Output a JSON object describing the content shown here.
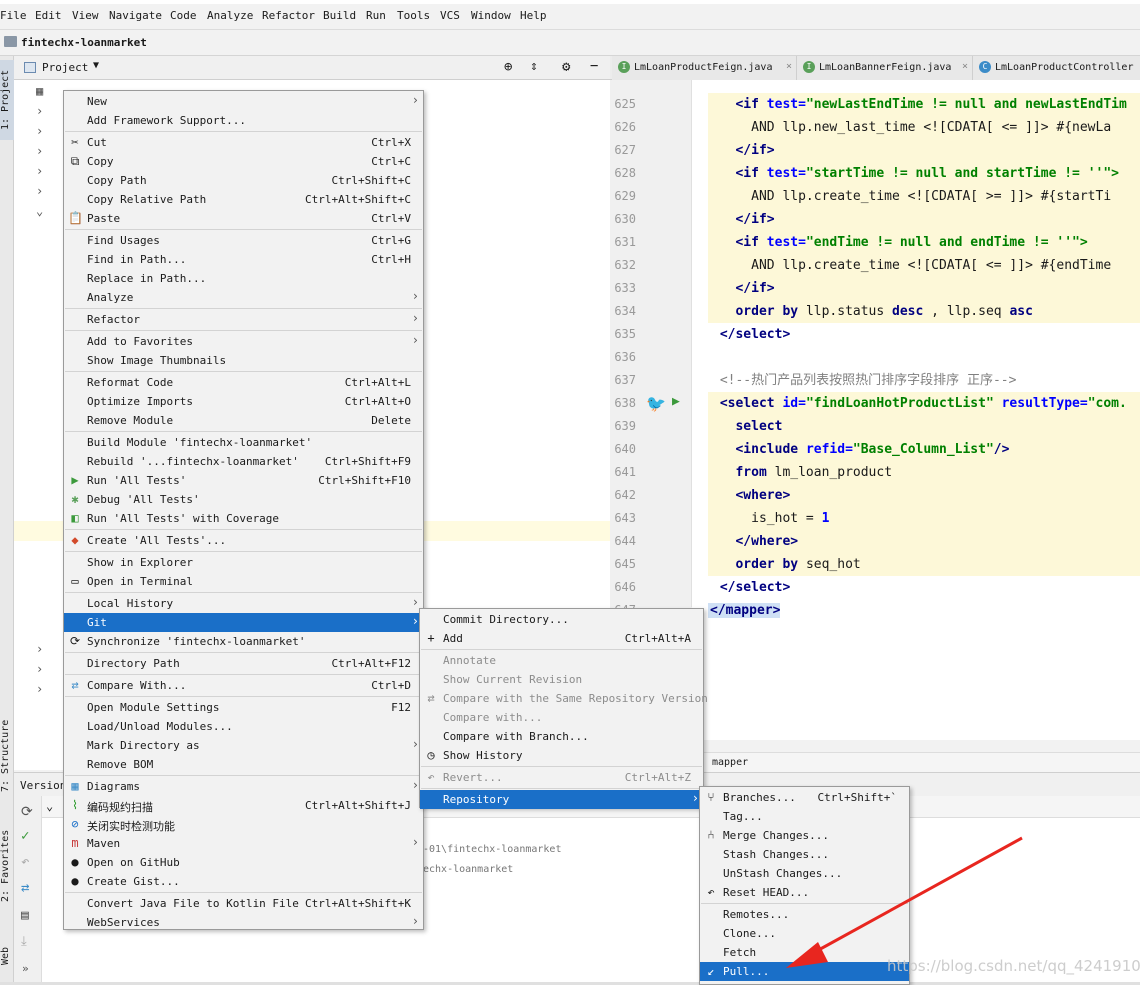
{
  "menubar": [
    "File",
    "Edit",
    "View",
    "Navigate",
    "Code",
    "Analyze",
    "Refactor",
    "Build",
    "Run",
    "Tools",
    "VCS",
    "Window",
    "Help"
  ],
  "project_title": "fintechx-loanmarket",
  "project_header": "Project",
  "left_strip": {
    "project": "1: Project",
    "structure": "7: Structure",
    "favorites": "2: Favorites",
    "web": "Web"
  },
  "tabs": [
    {
      "label": "LmLoanProductFeign.java",
      "icon": "I",
      "color": "#5aa05a"
    },
    {
      "label": "LmLoanBannerFeign.java",
      "icon": "I",
      "color": "#5aa05a"
    },
    {
      "label": "LmLoanProductController",
      "icon": "C",
      "color": "#3c8cc8"
    }
  ],
  "code_lines": [
    {
      "n": "625",
      "t": [
        [
          "   ",
          ""
        ],
        [
          "<if ",
          "tg"
        ],
        [
          "test=",
          "at"
        ],
        [
          "\"newLastEndTime != null and newLastEndTim",
          "vl"
        ]
      ]
    },
    {
      "n": "626",
      "t": [
        [
          "     AND llp.new_last_time <![CDATA[ <= ]]> #{newLa",
          ""
        ]
      ]
    },
    {
      "n": "627",
      "t": [
        [
          "   ",
          ""
        ],
        [
          "</if>",
          "tg"
        ]
      ]
    },
    {
      "n": "628",
      "t": [
        [
          "   ",
          ""
        ],
        [
          "<if ",
          "tg"
        ],
        [
          "test=",
          "at"
        ],
        [
          "\"startTime != null and startTime != ''\">",
          "vl"
        ]
      ]
    },
    {
      "n": "629",
      "t": [
        [
          "     AND llp.create_time <![CDATA[ >= ]]> #{startTi",
          ""
        ]
      ]
    },
    {
      "n": "630",
      "t": [
        [
          "   ",
          ""
        ],
        [
          "</if>",
          "tg"
        ]
      ]
    },
    {
      "n": "631",
      "t": [
        [
          "   ",
          ""
        ],
        [
          "<if ",
          "tg"
        ],
        [
          "test=",
          "at"
        ],
        [
          "\"endTime != null and endTime != ''\">",
          "vl"
        ]
      ]
    },
    {
      "n": "632",
      "t": [
        [
          "     AND llp.create_time <![CDATA[ <= ]]> #{endTime",
          ""
        ]
      ]
    },
    {
      "n": "633",
      "t": [
        [
          "   ",
          ""
        ],
        [
          "</if>",
          "tg"
        ]
      ]
    },
    {
      "n": "634",
      "t": [
        [
          "   ",
          ""
        ],
        [
          "order by ",
          "kw"
        ],
        [
          "llp.status ",
          ""
        ],
        [
          "desc",
          "kw"
        ],
        [
          " , llp.seq ",
          ""
        ],
        [
          "asc",
          "kw"
        ]
      ]
    },
    {
      "n": "635",
      "t": [
        [
          " ",
          ""
        ],
        [
          "</select>",
          "tg"
        ]
      ]
    },
    {
      "n": "636",
      "t": [
        [
          "",
          ""
        ]
      ]
    },
    {
      "n": "637",
      "t": [
        [
          " ",
          ""
        ],
        [
          "<!--热门产品列表按照热门排序字段排序 正序-->",
          "cm"
        ]
      ]
    },
    {
      "n": "638",
      "t": [
        [
          " ",
          ""
        ],
        [
          "<select ",
          "tg"
        ],
        [
          "id=",
          "at"
        ],
        [
          "\"findLoanHotProductList\" ",
          "vl"
        ],
        [
          "resultType=",
          "at"
        ],
        [
          "\"com.",
          "vl"
        ]
      ]
    },
    {
      "n": "639",
      "t": [
        [
          "   ",
          ""
        ],
        [
          "select",
          "kw"
        ]
      ]
    },
    {
      "n": "640",
      "t": [
        [
          "   ",
          ""
        ],
        [
          "<include ",
          "tg"
        ],
        [
          "refid=",
          "at"
        ],
        [
          "\"Base_Column_List\"",
          "vl"
        ],
        [
          "/>",
          "tg"
        ]
      ]
    },
    {
      "n": "641",
      "t": [
        [
          "   ",
          ""
        ],
        [
          "from ",
          "kw"
        ],
        [
          "lm_loan_product",
          ""
        ]
      ]
    },
    {
      "n": "642",
      "t": [
        [
          "   ",
          ""
        ],
        [
          "<where>",
          "tg"
        ]
      ]
    },
    {
      "n": "643",
      "t": [
        [
          "     is_hot = ",
          ""
        ],
        [
          "1",
          "at"
        ]
      ]
    },
    {
      "n": "644",
      "t": [
        [
          "   ",
          ""
        ],
        [
          "</where>",
          "tg"
        ]
      ]
    },
    {
      "n": "645",
      "t": [
        [
          "   ",
          ""
        ],
        [
          "order by ",
          "kw"
        ],
        [
          "seq_hot",
          ""
        ]
      ]
    },
    {
      "n": "646",
      "t": [
        [
          " ",
          ""
        ],
        [
          "</select>",
          "tg"
        ]
      ]
    },
    {
      "n": "647",
      "t": [
        [
          "",
          ""
        ],
        [
          "</mapper>",
          "tg"
        ]
      ]
    }
  ],
  "editor_breadcrumb": "mapper",
  "vc": {
    "title": "Version",
    "line1": "-01\\fintechx-loanmarket",
    "line2": "echx-loanmarket"
  },
  "main_menu": [
    {
      "label": "New",
      "arrow": true
    },
    {
      "label": "Add Framework Support..."
    },
    {
      "sep": true
    },
    {
      "label": "Cut",
      "sc": "Ctrl+X",
      "icon": "✂"
    },
    {
      "label": "Copy",
      "sc": "Ctrl+C",
      "icon": "⧉"
    },
    {
      "label": "Copy Path",
      "sc": "Ctrl+Shift+C"
    },
    {
      "label": "Copy Relative Path",
      "sc": "Ctrl+Alt+Shift+C"
    },
    {
      "label": "Paste",
      "sc": "Ctrl+V",
      "icon": "📋"
    },
    {
      "sep": true
    },
    {
      "label": "Find Usages",
      "sc": "Ctrl+G"
    },
    {
      "label": "Find in Path...",
      "sc": "Ctrl+H"
    },
    {
      "label": "Replace in Path..."
    },
    {
      "label": "Analyze",
      "arrow": true
    },
    {
      "sep": true
    },
    {
      "label": "Refactor",
      "arrow": true
    },
    {
      "sep": true
    },
    {
      "label": "Add to Favorites",
      "arrow": true
    },
    {
      "label": "Show Image Thumbnails"
    },
    {
      "sep": true
    },
    {
      "label": "Reformat Code",
      "sc": "Ctrl+Alt+L"
    },
    {
      "label": "Optimize Imports",
      "sc": "Ctrl+Alt+O"
    },
    {
      "label": "Remove Module",
      "sc": "Delete"
    },
    {
      "sep": true
    },
    {
      "label": "Build Module 'fintechx-loanmarket'"
    },
    {
      "label": "Rebuild '...fintechx-loanmarket'",
      "sc": "Ctrl+Shift+F9"
    },
    {
      "label": "Run 'All Tests'",
      "sc": "Ctrl+Shift+F10",
      "icon": "▶",
      "iconColor": "#3c9a3c"
    },
    {
      "label": "Debug 'All Tests'",
      "icon": "✱",
      "iconColor": "#5aa05a"
    },
    {
      "label": "Run 'All Tests' with Coverage",
      "icon": "◧",
      "iconColor": "#3c9a3c"
    },
    {
      "sep": true
    },
    {
      "label": "Create 'All Tests'...",
      "icon": "◆",
      "iconColor": "#d24a2a"
    },
    {
      "sep": true
    },
    {
      "label": "Show in Explorer"
    },
    {
      "label": "Open in Terminal",
      "icon": "▭"
    },
    {
      "sep": true
    },
    {
      "label": "Local History",
      "arrow": true
    },
    {
      "label": "Git",
      "arrow": true,
      "selected": true
    },
    {
      "label": "Synchronize 'fintechx-loanmarket'",
      "icon": "⟳"
    },
    {
      "sep": true
    },
    {
      "label": "Directory Path",
      "sc": "Ctrl+Alt+F12"
    },
    {
      "sep": true
    },
    {
      "label": "Compare With...",
      "sc": "Ctrl+D",
      "icon": "⇄",
      "iconColor": "#3c8cc8"
    },
    {
      "sep": true
    },
    {
      "label": "Open Module Settings",
      "sc": "F12"
    },
    {
      "label": "Load/Unload Modules..."
    },
    {
      "label": "Mark Directory as",
      "arrow": true
    },
    {
      "label": "Remove BOM"
    },
    {
      "sep": true
    },
    {
      "label": "Diagrams",
      "arrow": true,
      "icon": "▦",
      "iconColor": "#3c8cc8"
    },
    {
      "label": "编码规约扫描",
      "sc": "Ctrl+Alt+Shift+J",
      "icon": "⌇",
      "iconColor": "#2a9a2a"
    },
    {
      "label": "关闭实时检测功能",
      "icon": "⊘",
      "iconColor": "#1a6fc8"
    },
    {
      "label": "Maven",
      "arrow": true,
      "icon": "m",
      "iconColor": "#c83c3c"
    },
    {
      "label": "Open on GitHub",
      "icon": "●"
    },
    {
      "label": "Create Gist...",
      "icon": "●"
    },
    {
      "sep": true
    },
    {
      "label": "Convert Java File to Kotlin File",
      "sc": "Ctrl+Alt+Shift+K"
    },
    {
      "label": "WebServices",
      "arrow": true
    }
  ],
  "git_menu": [
    {
      "label": "Commit Directory..."
    },
    {
      "label": "Add",
      "sc": "Ctrl+Alt+A",
      "icon": "+"
    },
    {
      "sep": true
    },
    {
      "label": "Annotate",
      "disabled": true
    },
    {
      "label": "Show Current Revision",
      "disabled": true
    },
    {
      "label": "Compare with the Same Repository Version",
      "disabled": true,
      "icon": "⇄"
    },
    {
      "label": "Compare with...",
      "disabled": true
    },
    {
      "label": "Compare with Branch..."
    },
    {
      "label": "Show History",
      "icon": "◷"
    },
    {
      "sep": true
    },
    {
      "label": "Revert...",
      "sc": "Ctrl+Alt+Z",
      "disabled": true,
      "icon": "↶"
    },
    {
      "sep": true
    },
    {
      "label": "Repository",
      "arrow": true,
      "selected": true
    }
  ],
  "repo_menu": [
    {
      "label": "Branches...",
      "sc": "Ctrl+Shift+`",
      "icon": "⑂"
    },
    {
      "label": "Tag..."
    },
    {
      "label": "Merge Changes...",
      "icon": "⑃"
    },
    {
      "label": "Stash Changes..."
    },
    {
      "label": "UnStash Changes..."
    },
    {
      "label": "Reset HEAD...",
      "icon": "↶"
    },
    {
      "sep": true
    },
    {
      "label": "Remotes..."
    },
    {
      "label": "Clone..."
    },
    {
      "label": "Fetch"
    },
    {
      "label": "Pull...",
      "selected": true,
      "icon": "↙"
    }
  ],
  "watermark": "https://blog.csdn.net/qq_42419105"
}
